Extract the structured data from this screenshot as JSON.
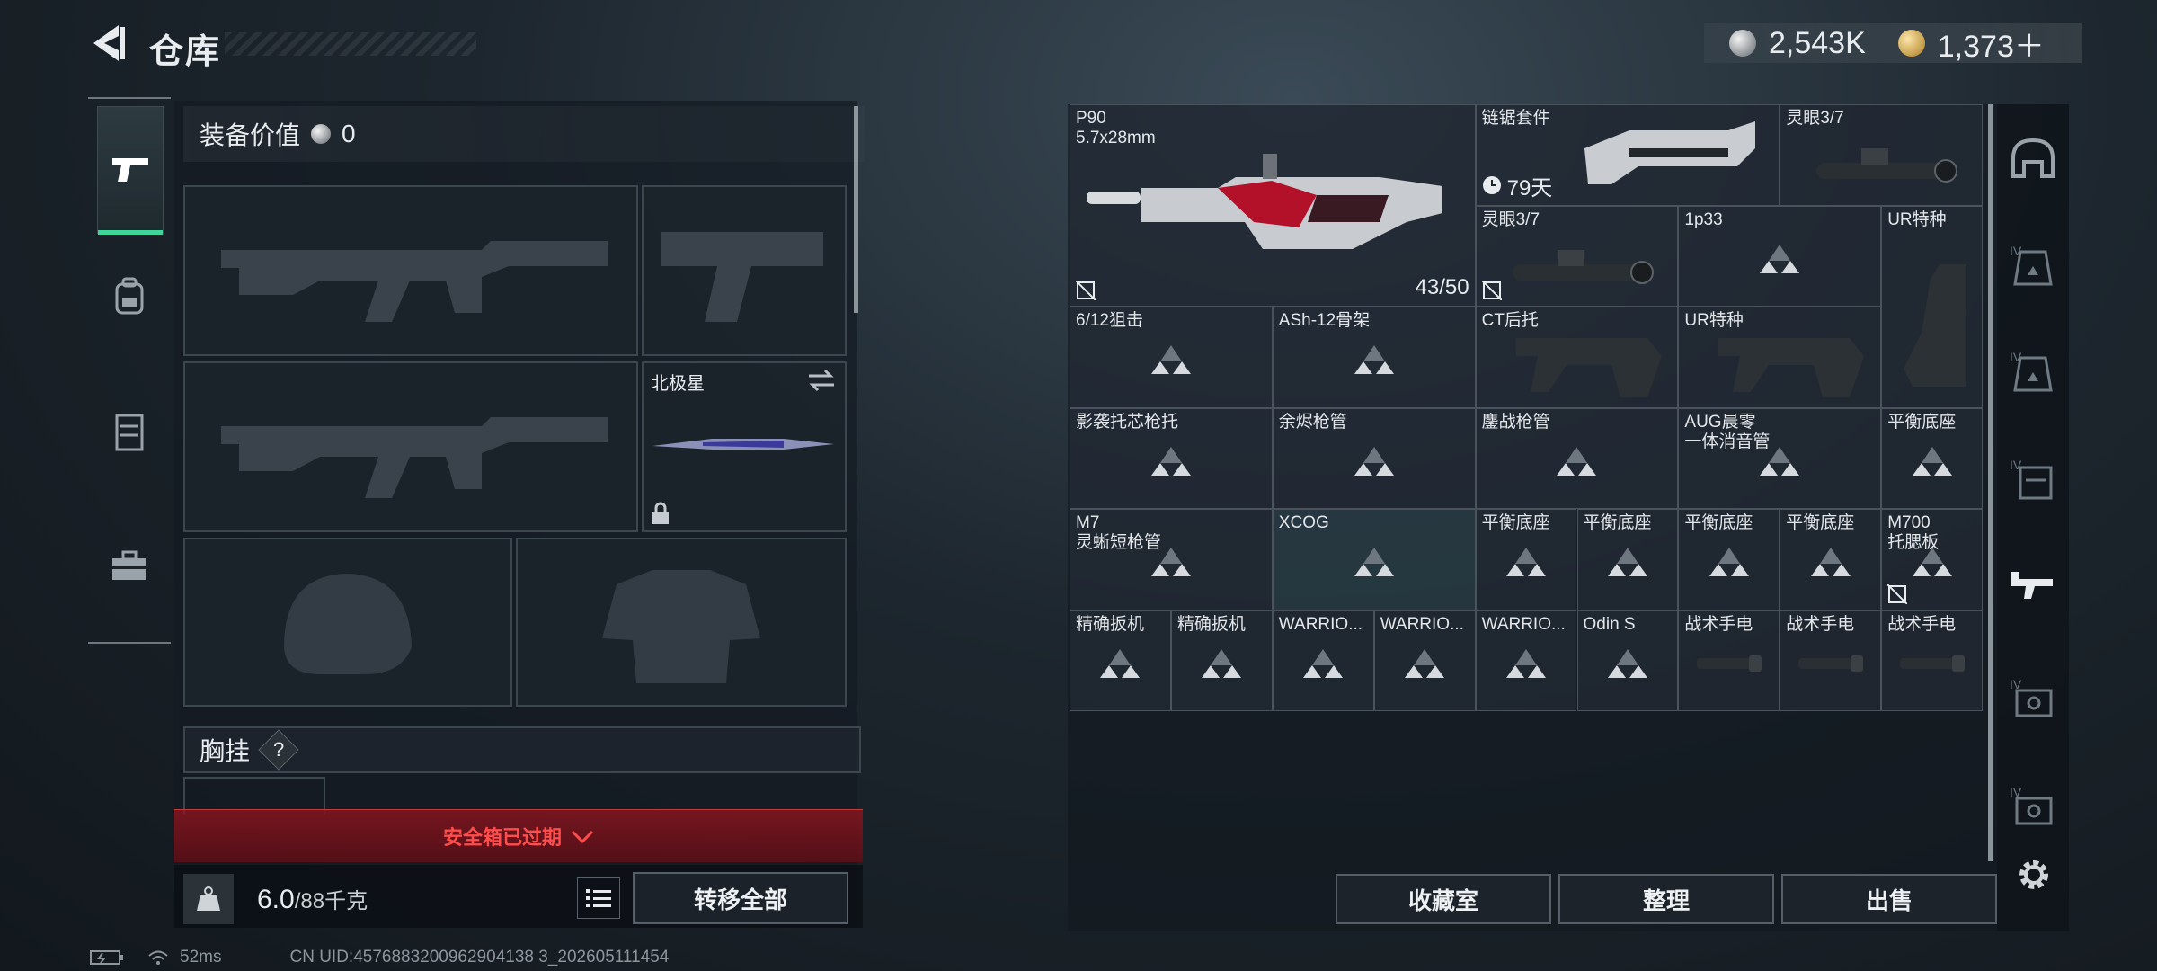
{
  "header": {
    "title": "仓库",
    "currency": [
      {
        "icon": "silver-coin-icon",
        "value": "2,543K"
      },
      {
        "icon": "gold-coin-icon",
        "value": "1,373＋"
      }
    ]
  },
  "left_tabs": [
    {
      "icon": "pistol-icon",
      "active": true
    },
    {
      "icon": "backpack-icon",
      "active": false
    },
    {
      "icon": "vest-icon",
      "active": false
    },
    {
      "icon": "briefcase-icon",
      "active": false
    }
  ],
  "loadout": {
    "equip_value_label": "装备价值",
    "equip_value": "0",
    "melee_name": "北极星",
    "chest_label": "胸挂",
    "chest_help": "?",
    "safe_box_expired": "安全箱已过期",
    "weight_current": "6.0",
    "weight_max": "/88千克",
    "transfer_all": "转移全部"
  },
  "storage": {
    "items": [
      {
        "id": "p90",
        "name": "P90\n5.7x28mm",
        "capacity": "43/50"
      },
      {
        "id": "chainsaw-kit",
        "name": "链锯套件",
        "timer": "79天"
      },
      {
        "id": "lingyan-a",
        "name": "灵眼3/7"
      },
      {
        "id": "lingyan-b",
        "name": "灵眼3/7"
      },
      {
        "id": "1p33",
        "name": "1p33"
      },
      {
        "id": "ur-stock-a",
        "name": "UR特种"
      },
      {
        "id": "sniper-612",
        "name": "6/12狙击"
      },
      {
        "id": "ash12",
        "name": "ASh-12骨架"
      },
      {
        "id": "ct-stock",
        "name": "CT后托"
      },
      {
        "id": "ur-stock-b",
        "name": "UR特种"
      },
      {
        "id": "shadow-stock",
        "name": "影袭托芯枪托"
      },
      {
        "id": "ember-barrel",
        "name": "余烬枪管"
      },
      {
        "id": "mochan-barrel",
        "name": "鏖战枪管"
      },
      {
        "id": "aug-suppressor",
        "name": "AUG晨零\n一体消音管"
      },
      {
        "id": "balance-mount-a",
        "name": "平衡底座"
      },
      {
        "id": "m7-barrel",
        "name": "M7\n灵蜥短枪管"
      },
      {
        "id": "xcog",
        "name": "XCOG"
      },
      {
        "id": "balance-mount-b",
        "name": "平衡底座"
      },
      {
        "id": "balance-mount-c",
        "name": "平衡底座"
      },
      {
        "id": "balance-mount-d",
        "name": "平衡底座"
      },
      {
        "id": "balance-mount-e",
        "name": "平衡底座"
      },
      {
        "id": "m700-cheek",
        "name": "M700\n托腮板"
      },
      {
        "id": "trigger-a",
        "name": "精确扳机"
      },
      {
        "id": "trigger-b",
        "name": "精确扳机"
      },
      {
        "id": "warrior-a",
        "name": "WARRIO..."
      },
      {
        "id": "warrior-b",
        "name": "WARRIO..."
      },
      {
        "id": "warrior-c",
        "name": "WARRIO..."
      },
      {
        "id": "odin",
        "name": "Odin S"
      },
      {
        "id": "flashlight-a",
        "name": "战术手电"
      },
      {
        "id": "flashlight-b",
        "name": "战术手电"
      },
      {
        "id": "flashlight-c",
        "name": "战术手电"
      }
    ],
    "buttons": {
      "collection": "收藏室",
      "sort": "整理",
      "sell": "出售"
    }
  },
  "right_tabs": [
    {
      "icon": "helmet-tab-icon",
      "level": ""
    },
    {
      "icon": "armor-tab-icon",
      "level": "IV"
    },
    {
      "icon": "armor-tab-icon",
      "level": "IV"
    },
    {
      "icon": "vest-tab-icon",
      "level": "IV"
    },
    {
      "icon": "rifle-tab-icon",
      "level": ""
    },
    {
      "icon": "case-tab-icon",
      "level": "IV"
    },
    {
      "icon": "case-tab-icon",
      "level": "IV"
    }
  ],
  "status": {
    "ping": "52ms",
    "uid": "CN UID:4576883200962904138 3_202605111454"
  },
  "colors": {
    "accent": "#3fd69a",
    "alert": "#ff4d4d"
  }
}
